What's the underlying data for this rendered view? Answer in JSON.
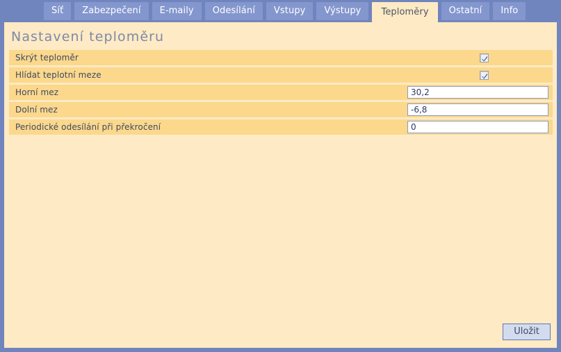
{
  "colors": {
    "frame_blue": "#7084be",
    "tab_blue": "#8496ce",
    "page_cream": "#feeac4",
    "row_amber": "#fbd88c",
    "title_gray_blue": "#7f88a8",
    "text_dark": "#3f4a63",
    "button_face": "#d3dcee",
    "button_border": "#5f76b4"
  },
  "tabs": [
    {
      "label": "Síť",
      "active": false
    },
    {
      "label": "Zabezpečení",
      "active": false
    },
    {
      "label": "E-maily",
      "active": false
    },
    {
      "label": "Odesílání",
      "active": false
    },
    {
      "label": "Vstupy",
      "active": false
    },
    {
      "label": "Výstupy",
      "active": false
    },
    {
      "label": "Teploměry",
      "active": true
    },
    {
      "label": "Ostatní",
      "active": false
    },
    {
      "label": "Info",
      "active": false
    }
  ],
  "page": {
    "title": "Nastavení teploměru"
  },
  "form": {
    "rows": [
      {
        "label": "Skrýt teploměr",
        "type": "checkbox",
        "checked": true
      },
      {
        "label": "Hlídat teplotní meze",
        "type": "checkbox",
        "checked": true
      },
      {
        "label": "Horní mez",
        "type": "text",
        "value": "30,2",
        "placeholder": ""
      },
      {
        "label": "Dolní mez",
        "type": "text",
        "value": "-6,8",
        "placeholder": ""
      },
      {
        "label": "Periodické odesílání při překročení",
        "type": "text",
        "value": "0",
        "placeholder": ""
      }
    ]
  },
  "actions": {
    "save_label": "Uložit"
  }
}
